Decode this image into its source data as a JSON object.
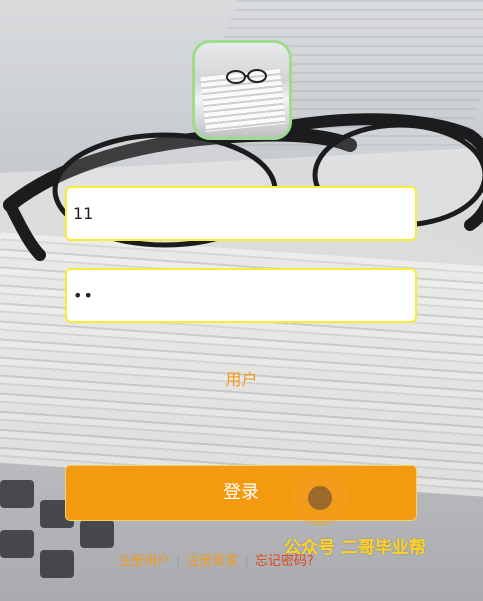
{
  "login_form": {
    "username_value": "11",
    "password_value": "••",
    "role_label": "用户",
    "login_button": "登录"
  },
  "links": {
    "register_user": "注册用户",
    "register_seller": "注册卖家",
    "forgot_password": "忘记密码?"
  },
  "watermark": {
    "text": "公众号 二哥毕业帮"
  },
  "colors": {
    "accent": "#f39a11",
    "input_border": "#f5ee38",
    "logo_border": "#9bdc8f",
    "forgot_link": "#e0471f"
  }
}
